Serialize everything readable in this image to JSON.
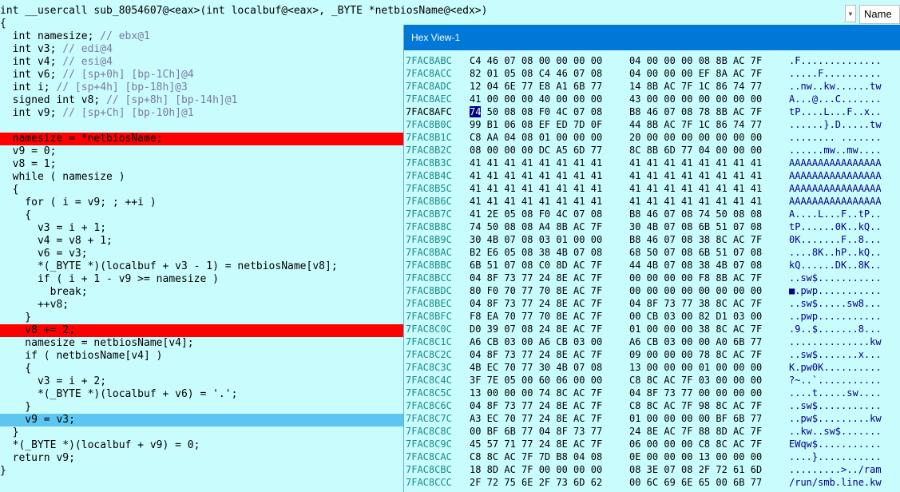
{
  "signature": "int __usercall sub_8054607@<eax>(int localbuf@<eax>, _BYTE *netbiosName@<edx>)",
  "name_column_label": "Name",
  "scroll_indicator": "▾",
  "hex_view_title": "Hex View-1",
  "pseudocode_lines": [
    {
      "text": "{",
      "hl": ""
    },
    {
      "text": "  int namesize; // ebx@1",
      "hl": ""
    },
    {
      "text": "  int v3; // edi@4",
      "hl": ""
    },
    {
      "text": "  int v4; // esi@4",
      "hl": ""
    },
    {
      "text": "  int v6; // [sp+0h] [bp-1Ch]@4",
      "hl": ""
    },
    {
      "text": "  int i; // [sp+4h] [bp-18h]@3",
      "hl": ""
    },
    {
      "text": "  signed int v8; // [sp+8h] [bp-14h]@1",
      "hl": ""
    },
    {
      "text": "  int v9; // [sp+Ch] [bp-10h]@1",
      "hl": ""
    },
    {
      "text": "",
      "hl": ""
    },
    {
      "text": "  namesize = *netbiosName;",
      "hl": "red"
    },
    {
      "text": "  v9 = 0;",
      "hl": ""
    },
    {
      "text": "  v8 = 1;",
      "hl": ""
    },
    {
      "text": "  while ( namesize )",
      "hl": ""
    },
    {
      "text": "  {",
      "hl": ""
    },
    {
      "text": "    for ( i = v9; ; ++i )",
      "hl": ""
    },
    {
      "text": "    {",
      "hl": ""
    },
    {
      "text": "      v3 = i + 1;",
      "hl": ""
    },
    {
      "text": "      v4 = v8 + 1;",
      "hl": ""
    },
    {
      "text": "      v6 = v3;",
      "hl": ""
    },
    {
      "text": "      *(_BYTE *)(localbuf + v3 - 1) = netbiosName[v8];",
      "hl": ""
    },
    {
      "text": "      if ( i + 1 - v9 >= namesize )",
      "hl": ""
    },
    {
      "text": "        break;",
      "hl": ""
    },
    {
      "text": "      ++v8;",
      "hl": ""
    },
    {
      "text": "    }",
      "hl": ""
    },
    {
      "text": "    v8 += 2;",
      "hl": "red"
    },
    {
      "text": "    namesize = netbiosName[v4];",
      "hl": ""
    },
    {
      "text": "    if ( netbiosName[v4] )",
      "hl": ""
    },
    {
      "text": "    {",
      "hl": ""
    },
    {
      "text": "      v3 = i + 2;",
      "hl": ""
    },
    {
      "text": "      *(_BYTE *)(localbuf + v6) = '.';",
      "hl": ""
    },
    {
      "text": "    }",
      "hl": ""
    },
    {
      "text": "    v9 = v3;",
      "hl": "blue"
    },
    {
      "text": "  }",
      "hl": ""
    },
    {
      "text": "  *(_BYTE *)(localbuf + v9) = 0;",
      "hl": ""
    },
    {
      "text": "  return v9;",
      "hl": ""
    },
    {
      "text": "}",
      "hl": ""
    }
  ],
  "hex_rows": [
    {
      "addr": "7FAC8ABC",
      "b1": "C4 46 07 08 00 00 00 00",
      "b2": "04 00 00 00 08 8B AC 7F",
      "ascii": ".F.............."
    },
    {
      "addr": "7FAC8ACC",
      "b1": "82 01 05 08 C4 46 07 08",
      "b2": "04 00 00 00 EF 8A AC 7F",
      "ascii": ".....F.........."
    },
    {
      "addr": "7FAC8ADC",
      "b1": "12 04 6E 77 E8 A1 6B 77",
      "b2": "14 8B AC 7F 1C 86 74 77",
      "ascii": "..nw..kw......tw"
    },
    {
      "addr": "7FAC8AEC",
      "b1": "41 00 00 00 40 00 00 00",
      "b2": "43 00 00 00 00 00 00 00",
      "ascii": "A...@...C......."
    },
    {
      "addr": "7FAC8AFC",
      "b1": "74 50 08 08 F0 4C 07 08",
      "b2": "B8 46 07 08 78 8B AC 7F",
      "ascii": "tP....L...F..x..",
      "current": true
    },
    {
      "addr": "7FAC8B0C",
      "b1": "99 B1 06 08 EF ED 7D 0F",
      "b2": "44 8B AC 7F 1C 86 74 77",
      "ascii": "......}.D.....tw"
    },
    {
      "addr": "7FAC8B1C",
      "b1": "C8 AA 04 08 01 00 00 00",
      "b2": "20 00 00 00 00 00 00 00",
      "ascii": "........ ......."
    },
    {
      "addr": "7FAC8B2C",
      "b1": "08 00 00 00 DC A5 6D 77",
      "b2": "8C 8B 6D 77 04 00 00 00",
      "ascii": "......mw..mw...."
    },
    {
      "addr": "7FAC8B3C",
      "b1": "41 41 41 41 41 41 41 41",
      "b2": "41 41 41 41 41 41 41 41",
      "ascii": "AAAAAAAAAAAAAAAA"
    },
    {
      "addr": "7FAC8B4C",
      "b1": "41 41 41 41 41 41 41 41",
      "b2": "41 41 41 41 41 41 41 41",
      "ascii": "AAAAAAAAAAAAAAAA"
    },
    {
      "addr": "7FAC8B5C",
      "b1": "41 41 41 41 41 41 41 41",
      "b2": "41 41 41 41 41 41 41 41",
      "ascii": "AAAAAAAAAAAAAAAA"
    },
    {
      "addr": "7FAC8B6C",
      "b1": "41 41 41 41 41 41 41 41",
      "b2": "41 41 41 41 41 41 41 41",
      "ascii": "AAAAAAAAAAAAAAAA"
    },
    {
      "addr": "7FAC8B7C",
      "b1": "41 2E 05 08 F0 4C 07 08",
      "b2": "B8 46 07 08 74 50 08 08",
      "ascii": "A....L...F..tP.."
    },
    {
      "addr": "7FAC8B8C",
      "b1": "74 50 08 08 A4 8B AC 7F",
      "b2": "30 4B 07 08 6B 51 07 08",
      "ascii": "tP......0K..kQ.."
    },
    {
      "addr": "7FAC8B9C",
      "b1": "30 4B 07 08 03 01 00 00",
      "b2": "B8 46 07 08 38 8C AC 7F",
      "ascii": "0K.......F..8..."
    },
    {
      "addr": "7FAC8BAC",
      "b1": "B2 E6 05 08 38 4B 07 08",
      "b2": "68 50 07 08 6B 51 07 08",
      "ascii": "....8K..hP..kQ.."
    },
    {
      "addr": "7FAC8BBC",
      "b1": "6B 51 07 08 C0 8D AC 7F",
      "b2": "44 4B 07 08 38 4B 07 08",
      "ascii": "kQ......DK..8K.."
    },
    {
      "addr": "7FAC8BCC",
      "b1": "04 8F 73 77 24 8E AC 7F",
      "b2": "00 00 00 00 F8 8B AC 7F",
      "ascii": "..sw$..........."
    },
    {
      "addr": "7FAC8BDC",
      "b1": "80 F0 70 77 70 8E AC 7F",
      "b2": "00 00 00 00 00 00 00 00",
      "ascii": "■.pwp..........."
    },
    {
      "addr": "7FAC8BEC",
      "b1": "04 8F 73 77 24 8E AC 7F",
      "b2": "04 8F 73 77 38 8C AC 7F",
      "ascii": "..sw$.....sw8..."
    },
    {
      "addr": "7FAC8BFC",
      "b1": "F8 EA 70 77 70 8E AC 7F",
      "b2": "00 CB 03 00 82 D1 03 00",
      "ascii": "..pwp..........."
    },
    {
      "addr": "7FAC8C0C",
      "b1": "D0 39 07 08 24 8E AC 7F",
      "b2": "01 00 00 00 38 8C AC 7F",
      "ascii": ".9..$.......8..."
    },
    {
      "addr": "7FAC8C1C",
      "b1": "A6 CB 03 00 A6 CB 03 00",
      "b2": "A6 CB 03 00 00 A0 6B 77",
      "ascii": "..............kw"
    },
    {
      "addr": "7FAC8C2C",
      "b1": "04 8F 73 77 24 8E AC 7F",
      "b2": "09 00 00 00 78 8C AC 7F",
      "ascii": "..sw$.......x..."
    },
    {
      "addr": "7FAC8C3C",
      "b1": "4B EC 70 77 30 4B 07 08",
      "b2": "13 00 00 00 01 00 00 00",
      "ascii": "K.pw0K.........."
    },
    {
      "addr": "7FAC8C4C",
      "b1": "3F 7E 05 00 60 06 00 00",
      "b2": "C8 8C AC 7F 03 00 00 00",
      "ascii": "?~..`..........."
    },
    {
      "addr": "7FAC8C5C",
      "b1": "13 00 00 00 74 8C AC 7F",
      "b2": "04 8F 73 77 00 00 00 00",
      "ascii": "....t.....sw...."
    },
    {
      "addr": "7FAC8C6C",
      "b1": "04 8F 73 77 24 8E AC 7F",
      "b2": "C8 8C AC 7F 98 8C AC 7F",
      "ascii": "..sw$..........."
    },
    {
      "addr": "7FAC8C7C",
      "b1": "A3 EC 70 77 24 8E AC 7F",
      "b2": "01 00 00 00 00 BF 6B 77",
      "ascii": "..pw$.........kw"
    },
    {
      "addr": "7FAC8C8C",
      "b1": "00 BF 6B 77 04 8F 73 77",
      "b2": "24 8E AC 7F 88 8D AC 7F",
      "ascii": "..kw..sw$......."
    },
    {
      "addr": "7FAC8C9C",
      "b1": "45 57 71 77 24 8E AC 7F",
      "b2": "06 00 00 00 C8 8C AC 7F",
      "ascii": "EWqw$..........."
    },
    {
      "addr": "7FAC8CAC",
      "b1": "C8 8C AC 7F 7D B8 04 08",
      "b2": "0E 00 00 00 13 00 00 00",
      "ascii": "....}..........."
    },
    {
      "addr": "7FAC8CBC",
      "b1": "18 8D AC 7F 00 00 00 00",
      "b2": "08 3E 07 08 2F 72 61 6D",
      "ascii": ".........>../ram"
    },
    {
      "addr": "7FAC8CCC",
      "b1": "2F 72 75 6E 2F 73 6D 62",
      "b2": "00 6C 69 6E 65 00 6B 77",
      "ascii": "/run/smb.line.kw"
    }
  ],
  "colors": {
    "background": "#c9fcfd",
    "highlight_red": "#ff0000",
    "highlight_blue": "#5cc6f0",
    "title_bar": "#0078d7",
    "address": "#1a8a8a",
    "ascii": "#00008b"
  }
}
